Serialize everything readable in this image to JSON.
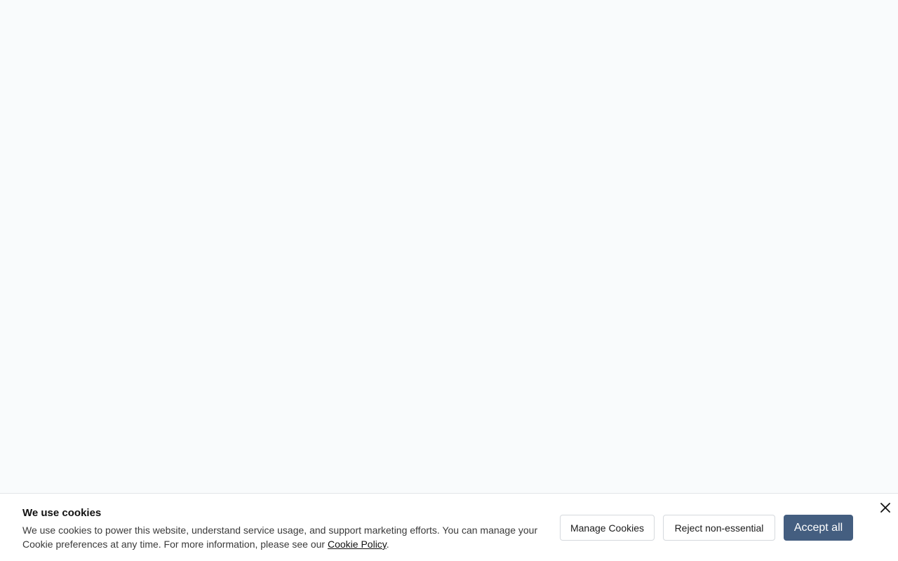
{
  "cookie_banner": {
    "title": "We use cookies",
    "body_text": "We use cookies to power this website, understand service usage, and support marketing efforts. You can manage your Cookie preferences at any time. For more information, please see our ",
    "link_text": "Cookie Policy",
    "body_suffix": ".",
    "buttons": {
      "manage": "Manage Cookies",
      "reject": "Reject non-essential",
      "accept": "Accept all"
    },
    "close_icon": "close-icon"
  },
  "colors": {
    "page_background": "#f9fbfc",
    "banner_background": "#ffffff",
    "accent": "#445e80",
    "button_border": "#d5d9dd"
  }
}
